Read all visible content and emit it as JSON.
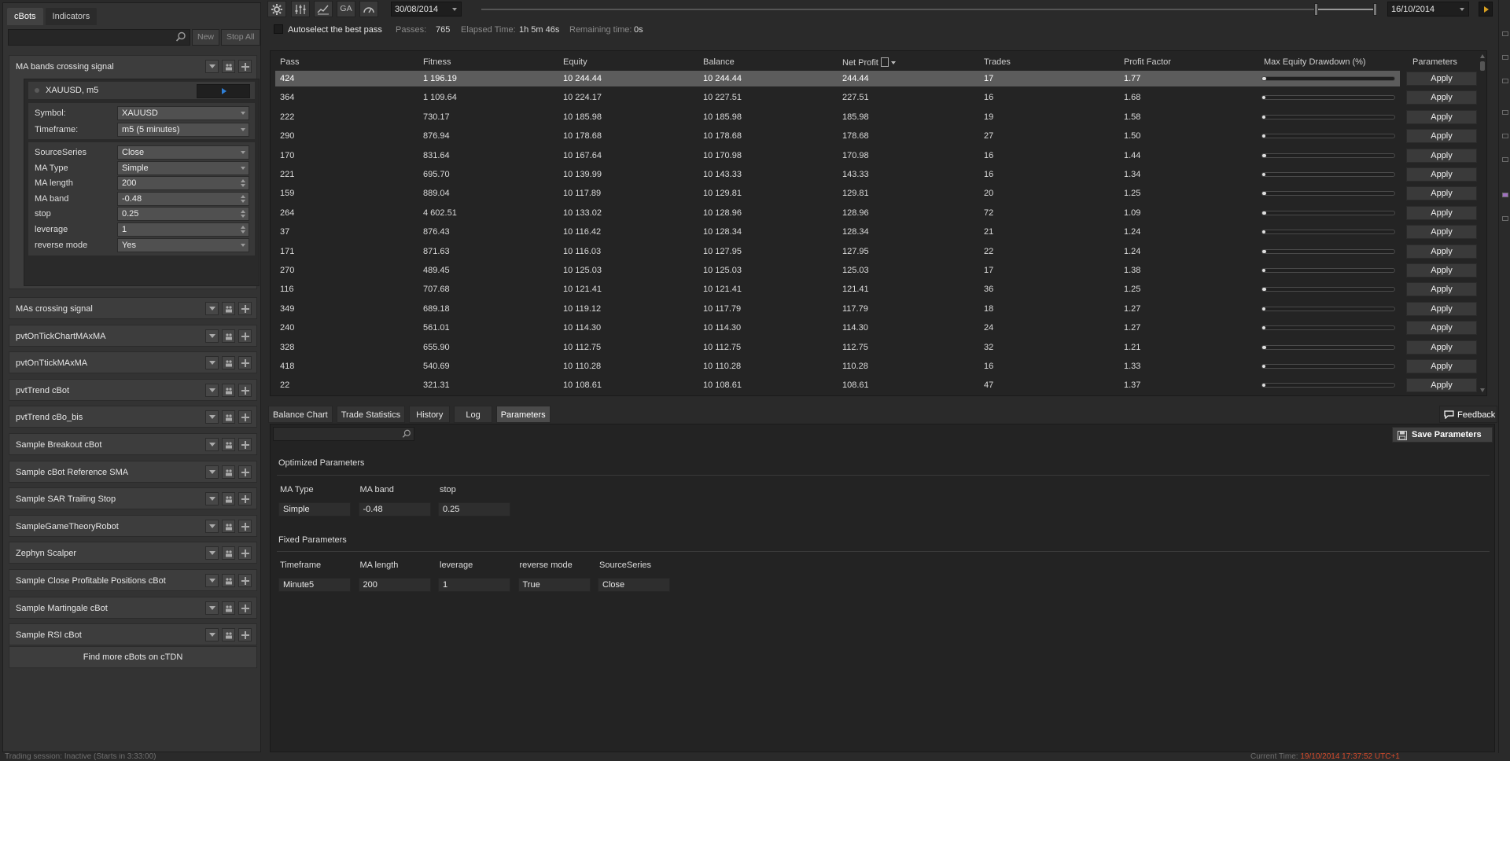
{
  "left_panel": {
    "tabs": [
      "cBots",
      "Indicators"
    ],
    "new_label": "New",
    "stop_all_label": "Stop All",
    "expanded_bot": {
      "name": "MA bands crossing signal",
      "instance": "XAUUSD, m5",
      "symbol_label": "Symbol:",
      "symbol_value": "XAUUSD",
      "timeframe_label": "Timeframe:",
      "timeframe_value": "m5 (5 minutes)",
      "params": [
        {
          "label": "SourceSeries",
          "value": "Close",
          "kind": "select"
        },
        {
          "label": "MA Type",
          "value": "Simple",
          "kind": "select"
        },
        {
          "label": "MA length",
          "value": "200",
          "kind": "spin"
        },
        {
          "label": "MA band",
          "value": "-0.48",
          "kind": "spin"
        },
        {
          "label": "stop",
          "value": "0.25",
          "kind": "spin"
        },
        {
          "label": "leverage",
          "value": "1",
          "kind": "spin"
        },
        {
          "label": "reverse mode",
          "value": "Yes",
          "kind": "select"
        }
      ]
    },
    "bots": [
      "MAs crossing signal",
      "pvtOnTickChartMAxMA",
      "pvtOnTtickMAxMA",
      "pvtTrend cBot",
      "pvtTrend cBo_bis",
      "Sample Breakout cBot",
      "Sample cBot Reference SMA",
      "Sample SAR Trailing Stop",
      "SampleGameTheoryRobot",
      "Zephyn Scalper",
      "Sample Close Profitable Positions cBot",
      "Sample Martingale cBot",
      "Sample RSI cBot"
    ],
    "find_more": "Find more cBots on cTDN"
  },
  "toolbar": {
    "ga_label": "GA",
    "start_date": "30/08/2014",
    "end_date": "16/10/2014"
  },
  "status_line": {
    "autoselect_label": "Autoselect the best pass",
    "passes_label": "Passes:",
    "passes_value": "765",
    "elapsed_label": "Elapsed Time:",
    "elapsed_value": "1h 5m 46s",
    "remaining_label": "Remaining time:",
    "remaining_value": "0s"
  },
  "table": {
    "headers": [
      "Pass",
      "Fitness",
      "Equity",
      "Balance",
      "Net Profit",
      "Trades",
      "Profit Factor",
      "Max Equity Drawdown (%)",
      "Parameters"
    ],
    "apply_label": "Apply",
    "rows": [
      {
        "pass": "424",
        "fitness": "1 196.19",
        "equity": "10 244.44",
        "balance": "10 244.44",
        "net_profit": "244.44",
        "trades": "17",
        "profit_factor": "1.77",
        "drawdown": 0.03
      },
      {
        "pass": "364",
        "fitness": "1 109.64",
        "equity": "10 224.17",
        "balance": "10 227.51",
        "net_profit": "227.51",
        "trades": "16",
        "profit_factor": "1.68",
        "drawdown": 0.02
      },
      {
        "pass": "222",
        "fitness": "730.17",
        "equity": "10 185.98",
        "balance": "10 185.98",
        "net_profit": "185.98",
        "trades": "19",
        "profit_factor": "1.58",
        "drawdown": 0.02
      },
      {
        "pass": "290",
        "fitness": "876.94",
        "equity": "10 178.68",
        "balance": "10 178.68",
        "net_profit": "178.68",
        "trades": "27",
        "profit_factor": "1.50",
        "drawdown": 0.02
      },
      {
        "pass": "170",
        "fitness": "831.64",
        "equity": "10 167.64",
        "balance": "10 170.98",
        "net_profit": "170.98",
        "trades": "16",
        "profit_factor": "1.44",
        "drawdown": 0.03
      },
      {
        "pass": "221",
        "fitness": "695.70",
        "equity": "10 139.99",
        "balance": "10 143.33",
        "net_profit": "143.33",
        "trades": "16",
        "profit_factor": "1.34",
        "drawdown": 0.02
      },
      {
        "pass": "159",
        "fitness": "889.04",
        "equity": "10 117.89",
        "balance": "10 129.81",
        "net_profit": "129.81",
        "trades": "20",
        "profit_factor": "1.25",
        "drawdown": 0.03
      },
      {
        "pass": "264",
        "fitness": "4 602.51",
        "equity": "10 133.02",
        "balance": "10 128.96",
        "net_profit": "128.96",
        "trades": "72",
        "profit_factor": "1.09",
        "drawdown": 0.03
      },
      {
        "pass": "37",
        "fitness": "876.43",
        "equity": "10 116.42",
        "balance": "10 128.34",
        "net_profit": "128.34",
        "trades": "21",
        "profit_factor": "1.24",
        "drawdown": 0.02
      },
      {
        "pass": "171",
        "fitness": "871.63",
        "equity": "10 116.03",
        "balance": "10 127.95",
        "net_profit": "127.95",
        "trades": "22",
        "profit_factor": "1.24",
        "drawdown": 0.03
      },
      {
        "pass": "270",
        "fitness": "489.45",
        "equity": "10 125.03",
        "balance": "10 125.03",
        "net_profit": "125.03",
        "trades": "17",
        "profit_factor": "1.38",
        "drawdown": 0.02
      },
      {
        "pass": "116",
        "fitness": "707.68",
        "equity": "10 121.41",
        "balance": "10 121.41",
        "net_profit": "121.41",
        "trades": "36",
        "profit_factor": "1.25",
        "drawdown": 0.03
      },
      {
        "pass": "349",
        "fitness": "689.18",
        "equity": "10 119.12",
        "balance": "10 117.79",
        "net_profit": "117.79",
        "trades": "18",
        "profit_factor": "1.27",
        "drawdown": 0.02
      },
      {
        "pass": "240",
        "fitness": "561.01",
        "equity": "10 114.30",
        "balance": "10 114.30",
        "net_profit": "114.30",
        "trades": "24",
        "profit_factor": "1.27",
        "drawdown": 0.02
      },
      {
        "pass": "328",
        "fitness": "655.90",
        "equity": "10 112.75",
        "balance": "10 112.75",
        "net_profit": "112.75",
        "trades": "32",
        "profit_factor": "1.21",
        "drawdown": 0.03
      },
      {
        "pass": "418",
        "fitness": "540.69",
        "equity": "10 110.28",
        "balance": "10 110.28",
        "net_profit": "110.28",
        "trades": "16",
        "profit_factor": "1.33",
        "drawdown": 0.02
      },
      {
        "pass": "22",
        "fitness": "321.31",
        "equity": "10 108.61",
        "balance": "10 108.61",
        "net_profit": "108.61",
        "trades": "47",
        "profit_factor": "1.37",
        "drawdown": 0.02
      }
    ]
  },
  "bottom": {
    "tabs": [
      "Balance Chart",
      "Trade Statistics",
      "History",
      "Log",
      "Parameters"
    ],
    "active_tab": "Parameters",
    "feedback_label": "Feedback",
    "save_label": "Save Parameters",
    "optimized_title": "Optimized Parameters",
    "optimized": [
      {
        "name": "MA Type",
        "value": "Simple"
      },
      {
        "name": "MA band",
        "value": "-0.48"
      },
      {
        "name": "stop",
        "value": "0.25"
      }
    ],
    "fixed_title": "Fixed Parameters",
    "fixed": [
      {
        "name": "Timeframe",
        "value": "Minute5"
      },
      {
        "name": "MA length",
        "value": "200"
      },
      {
        "name": "leverage",
        "value": "1"
      },
      {
        "name": "reverse mode",
        "value": "True"
      },
      {
        "name": "SourceSeries",
        "value": "Close"
      }
    ]
  },
  "status_bar": {
    "left": "Trading session: Inactive (Starts in 3:33:00)",
    "right_label": "Current Time:",
    "right_value": "19/10/2014 17:37:52 UTC+1"
  }
}
